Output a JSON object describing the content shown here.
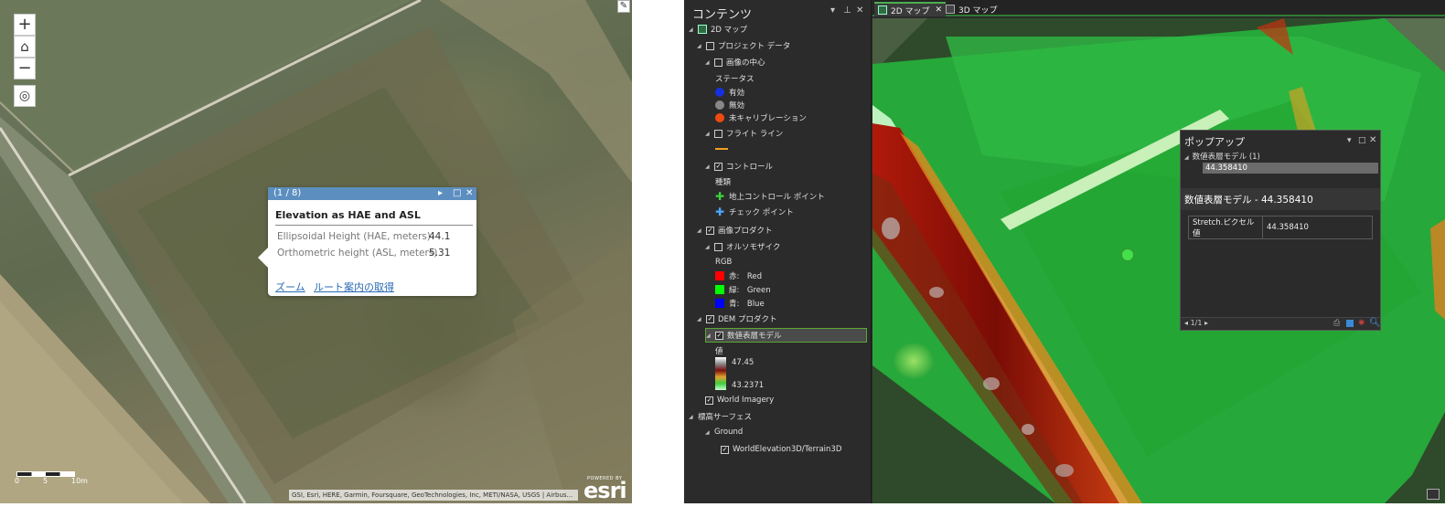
{
  "web_map": {
    "zoom_in": "+",
    "zoom_out": "−",
    "home": "⌂",
    "locate": "◎",
    "popup": {
      "counter": "(1 / 8)",
      "title": "Elevation as HAE and ASL",
      "fields": [
        {
          "label": "Ellipsoidal Height (HAE, meters)",
          "value": "44.1"
        },
        {
          "label": "Orthometric height (ASL, meters)",
          "value": "5.31"
        }
      ],
      "zoom_link": "ズーム",
      "directions_link": "ルート案内の取得"
    },
    "scale": {
      "left": "0",
      "mid": "5",
      "right": "10m"
    },
    "attribution": "GSI, Esri, HERE, Garmin, Foursquare, GeoTechnologies, Inc, METI/NASA, USGS | Airbus...",
    "logo": {
      "powered": "POWERED BY",
      "name": "esri"
    }
  },
  "pro": {
    "contents": {
      "title": "コンテンツ",
      "items": {
        "map2d": "2D マップ",
        "project_data": "プロジェクト データ",
        "image_centers": "画像の中心",
        "status": "ステータス",
        "valid": "有効",
        "invalid": "無効",
        "uncalibrated": "未キャリブレーション",
        "flight_lines": "フライト ライン",
        "control": "コントロール",
        "type": "種類",
        "gcp": "地上コントロール ポイント",
        "checkpoint": "チェック ポイント",
        "image_products": "画像プロダクト",
        "ortho": "オルソモザイク",
        "rgb": "RGB",
        "red": "赤:　Red",
        "green": "緑:　Green",
        "blue": "青:　Blue",
        "dem_products": "DEM プロダクト",
        "dsm": "数値表層モデル",
        "value": "値",
        "val_high": "47.45",
        "val_low": "43.2371",
        "world_imagery": "World Imagery",
        "elevation_surfaces": "標高サーフェス",
        "ground": "Ground",
        "terrain": "WorldElevation3D/Terrain3D"
      }
    },
    "tabs": [
      "2D マップ",
      "3D マップ"
    ],
    "popup": {
      "title": "ポップアップ",
      "layer": "数値表層モデル (1)",
      "selected": "44.358410",
      "feature_title": "数値表層モデル - 44.358410",
      "field_name": "Stretch.ピクセル値",
      "field_value": "44.358410",
      "page": "1/1"
    }
  }
}
